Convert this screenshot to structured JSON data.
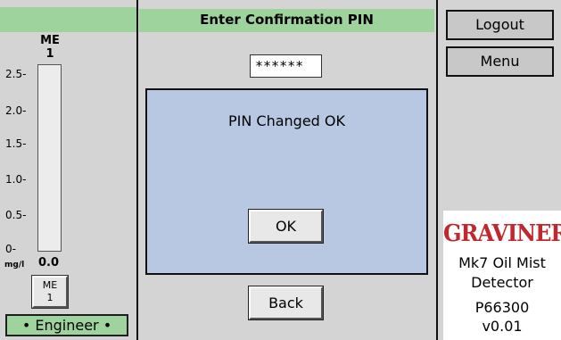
{
  "left_panel": {
    "meter_label": "ME",
    "meter_index": "1",
    "scale": [
      "2.5-",
      "2.0-",
      "1.5-",
      "1.0-",
      "0.5-",
      "0-"
    ],
    "unit": "mg/l",
    "reading": "0.0",
    "me_button": {
      "line1": "ME",
      "line2": "1"
    },
    "mode_badge": "• Engineer •"
  },
  "center_panel": {
    "title": "Enter Confirmation PIN",
    "pin_value": "******",
    "dialog_message": "PIN Changed OK",
    "ok_label": "OK",
    "back_label": "Back"
  },
  "right_panel": {
    "logout_label": "Logout",
    "menu_label": "Menu",
    "brand": "GRAVINER",
    "product_line1": "Mk7 Oil Mist",
    "product_line2": "Detector",
    "part_number": "P66300",
    "version": "v0.01"
  },
  "colors": {
    "accent_green": "#9ed39e",
    "panel_gray": "#d4d4d4",
    "dialog_blue": "#b8c8e2",
    "brand_red": "#c0282e"
  }
}
